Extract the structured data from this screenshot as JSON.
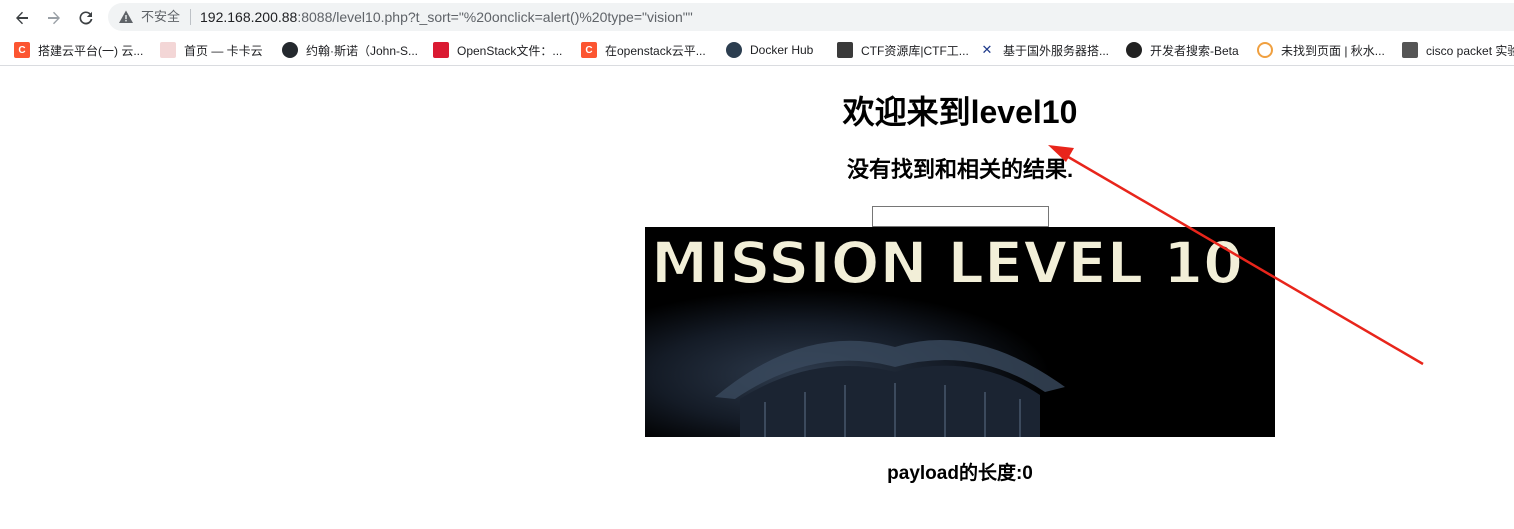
{
  "browser": {
    "security_label": "不安全",
    "url_host": "192.168.200.88",
    "url_rest": ":8088/level10.php?t_sort=\"%20onclick=alert()%20type=\"vision\"\""
  },
  "bookmarks": [
    {
      "label": "搭建云平台(一) 云...",
      "icon": "csdn-icon",
      "color": "#fc5531",
      "glyph": "C"
    },
    {
      "label": "首页 — 卡卡云",
      "icon": "kakayun-icon",
      "color": "#f3d6d6",
      "glyph": ""
    },
    {
      "label": "约翰·斯诺（John-S...",
      "icon": "github-icon",
      "color": "#24292e",
      "glyph": ""
    },
    {
      "label": "OpenStack文件：...",
      "icon": "openstack-icon",
      "color": "#da1a32",
      "glyph": ""
    },
    {
      "label": "在openstack云平...",
      "icon": "csdn-icon",
      "color": "#fc5531",
      "glyph": "C"
    },
    {
      "label": "Docker Hub",
      "icon": "docker-icon",
      "color": "#2c3e50",
      "glyph": ""
    },
    {
      "label": "CTF资源库|CTF工...",
      "icon": "ctf-icon",
      "color": "#3a3a3a",
      "glyph": ""
    },
    {
      "label": "基于国外服务器搭...",
      "icon": "cross-icon",
      "color": "#1e3a8a",
      "glyph": "✕"
    },
    {
      "label": "开发者搜索-Beta",
      "icon": "globe-icon",
      "color": "#222222",
      "glyph": ""
    },
    {
      "label": "未找到页面 | 秋水...",
      "icon": "circle-icon",
      "color": "#f0a040",
      "glyph": ""
    },
    {
      "label": "cisco packet 实验",
      "icon": "cisco-icon",
      "color": "#555555",
      "glyph": ""
    }
  ],
  "page": {
    "heading": "欢迎来到level10",
    "no_result": "没有找到和相关的结果.",
    "search_value": "",
    "banner_text": "MISSION LEVEL 10",
    "payload_label": "payload的长度:0"
  },
  "colors": {
    "arrow": "#e8251b",
    "banner_text": "#f2efd8"
  }
}
